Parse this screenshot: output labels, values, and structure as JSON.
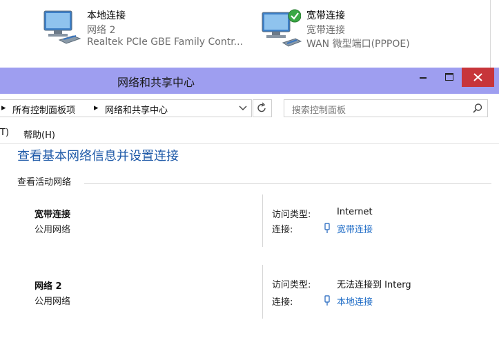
{
  "connections_window": {
    "items": [
      {
        "name": "本地连接",
        "line2": "网络  2",
        "line3": "Realtek PCIe GBE Family Contr..."
      },
      {
        "name": "宽带连接",
        "line2": "宽带连接",
        "line3": "WAN 微型端口(PPPOE)"
      }
    ]
  },
  "window": {
    "title": "网络和共享中心",
    "breadcrumb": [
      "所有控制面板项",
      "网络和共享中心"
    ],
    "search_placeholder": "搜索控制面板",
    "menu": [
      "T)",
      "帮助(H)"
    ]
  },
  "main": {
    "heading": "查看基本网络信息并设置连接",
    "active_section": "查看活动网络",
    "networks": [
      {
        "name": "宽带连接",
        "category": "公用网络",
        "access_label": "访问类型:",
        "access_value": "Internet",
        "conn_label": "连接:",
        "conn_value": "宽带连接"
      },
      {
        "name": "网络  2",
        "category": "公用网络",
        "access_label": "访问类型:",
        "access_value": "无法连接到 Interg",
        "conn_label": "连接:",
        "conn_value": "本地连接"
      }
    ]
  },
  "colors": {
    "titlebar": "#9e9ef0",
    "close": "#c7353a",
    "link": "#1d6bc6",
    "heading": "#1f5aa8"
  }
}
